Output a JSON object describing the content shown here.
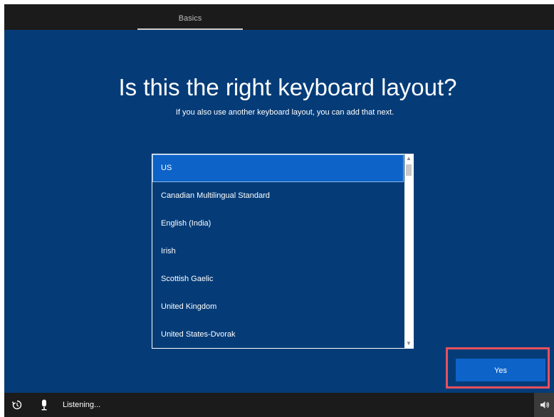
{
  "header": {
    "step_label": "Basics"
  },
  "main": {
    "title": "Is this the right keyboard layout?",
    "subtitle": "If you also use another keyboard layout, you can add that next.",
    "layouts": [
      {
        "label": "US",
        "selected": true
      },
      {
        "label": "Canadian Multilingual Standard",
        "selected": false
      },
      {
        "label": "English (India)",
        "selected": false
      },
      {
        "label": "Irish",
        "selected": false
      },
      {
        "label": "Scottish Gaelic",
        "selected": false
      },
      {
        "label": "United Kingdom",
        "selected": false
      },
      {
        "label": "United States-Dvorak",
        "selected": false
      }
    ],
    "yes_label": "Yes"
  },
  "footer": {
    "status_text": "Listening...",
    "icons": [
      "ease-of-access-icon",
      "microphone-icon",
      "volume-icon"
    ]
  },
  "colors": {
    "background": "#053c78",
    "accent": "#0e63c9",
    "highlight_outline": "#e8505f",
    "bar": "#1b1b1b"
  }
}
